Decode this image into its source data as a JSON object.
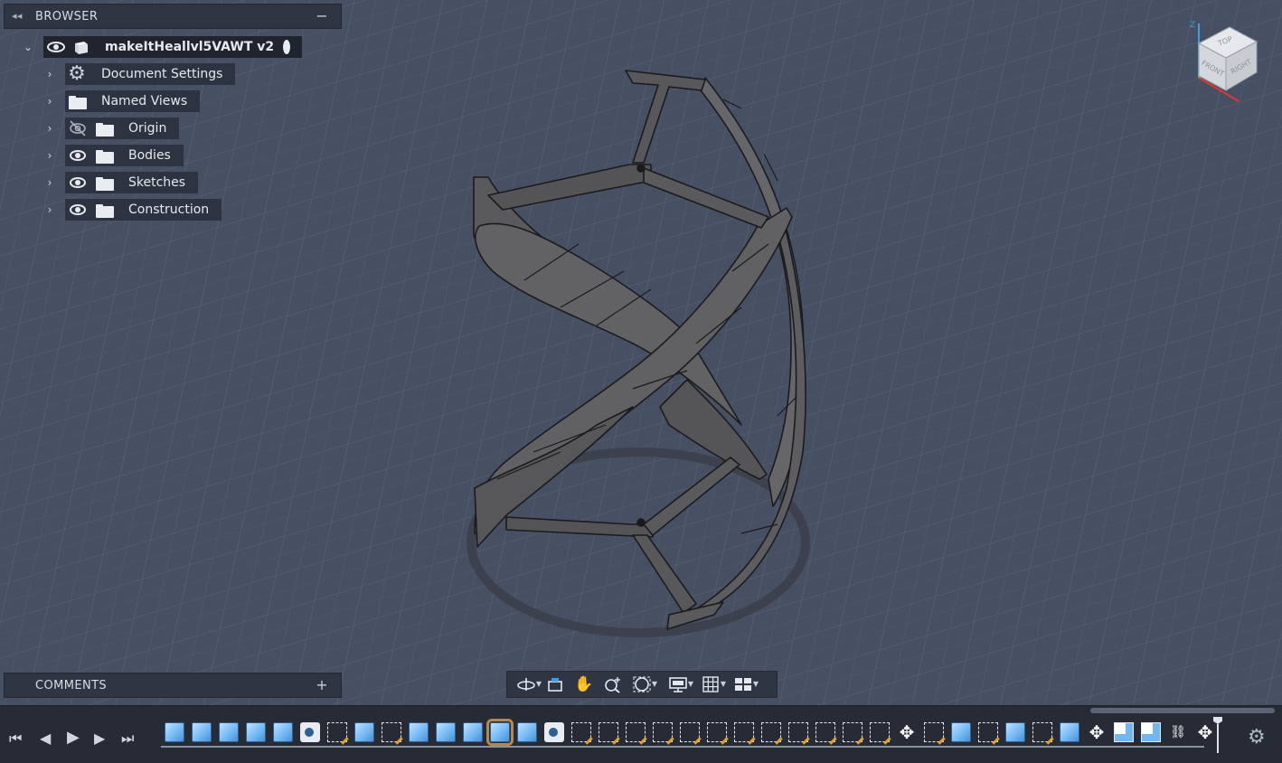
{
  "browser": {
    "title": "BROWSER",
    "collapse_glyph": "◂◂",
    "minus_glyph": "−",
    "root": {
      "label": "makeItHeallvl5VAWT v2"
    },
    "items": [
      {
        "label": "Document Settings",
        "icon": "gear-icon"
      },
      {
        "label": "Named Views",
        "icon": "folder-icon"
      },
      {
        "label": "Origin",
        "icon": "folder-icon",
        "visibility": "hidden"
      },
      {
        "label": "Bodies",
        "icon": "folder-icon",
        "visibility": "visible"
      },
      {
        "label": "Sketches",
        "icon": "folder-icon",
        "visibility": "visible"
      },
      {
        "label": "Construction",
        "icon": "folder-icon",
        "visibility": "visible"
      }
    ]
  },
  "comments": {
    "title": "COMMENTS",
    "plus_glyph": "+"
  },
  "viewcube": {
    "top": "TOP",
    "front": "FRONT",
    "right": "RIGHT",
    "axis_z": "Z"
  },
  "navbar": {
    "buttons": [
      "orbit-icon",
      "look-at-icon",
      "pan-icon",
      "zoom-icon",
      "fit-icon",
      "display-settings-icon",
      "grid-settings-icon",
      "viewports-icon"
    ]
  },
  "timeline": {
    "controls": [
      "⏮",
      "◀",
      "▶",
      "▶",
      "⏭"
    ],
    "features": [
      "extrude",
      "extrude",
      "extrude",
      "extrude",
      "extrude",
      "body",
      "sketch",
      "extrude",
      "sketch",
      "extrude",
      "extrude",
      "extrude",
      "extrude-selected",
      "extrude",
      "body",
      "sketch",
      "sketch",
      "sketch",
      "sketch",
      "sketch",
      "sketch",
      "sketch",
      "sketch",
      "sketch",
      "sketch",
      "sketch",
      "sketch",
      "move",
      "sketch",
      "extrude",
      "sketch",
      "extrude",
      "sketch",
      "extrude",
      "move",
      "combine",
      "combine",
      "joint",
      "move"
    ]
  },
  "colors": {
    "viewport_bg": "#475063",
    "panel_bg": "#2f3542",
    "timeline_bg": "#262b36",
    "model_gray": "#5b5b5d",
    "selection_accent": "#b38a4b"
  }
}
